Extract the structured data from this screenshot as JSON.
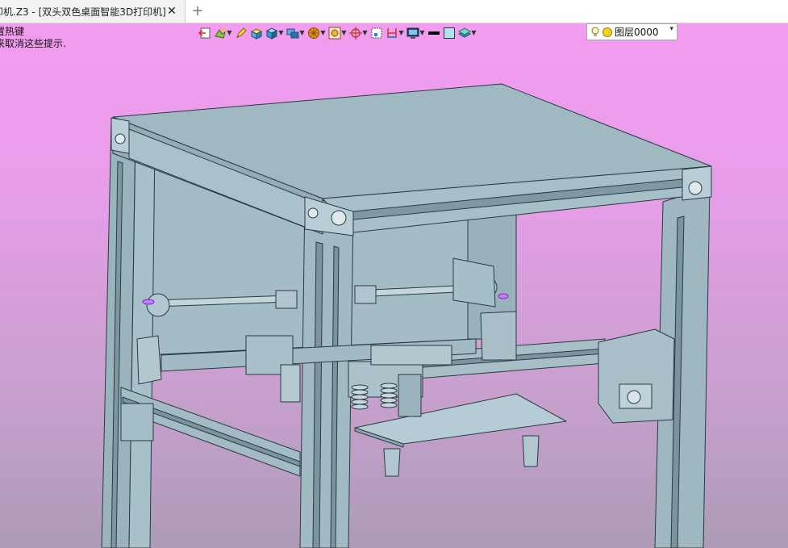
{
  "window": {
    "tab_title": "印机.Z3 - [双头双色桌面智能3D打印机]",
    "tab_close": "✕",
    "tab_add": "+"
  },
  "hint": {
    "line1": "置热键",
    "line2": "来取消这些提示."
  },
  "layer": {
    "name": "图层0000",
    "arrow": "▾"
  },
  "colors": {
    "model_fill": "#9fb8c2",
    "model_stroke": "#2a3a40",
    "background_top": "#f59cf2",
    "background_bottom": "#ad9bb7"
  }
}
